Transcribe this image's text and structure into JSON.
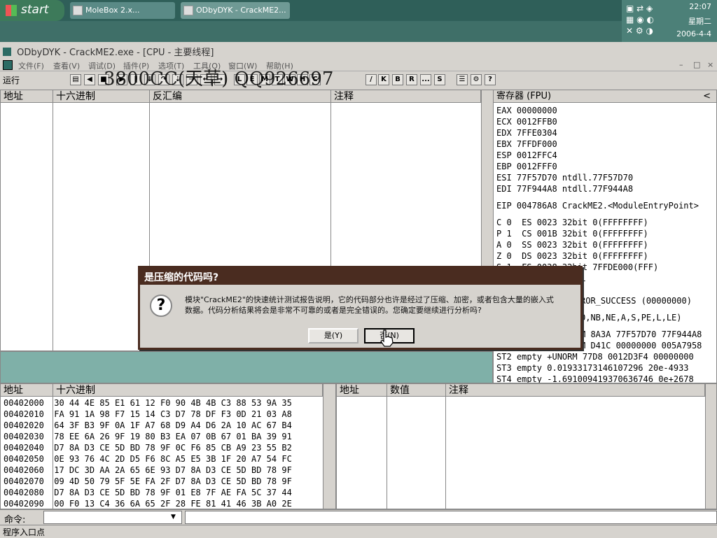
{
  "taskbar": {
    "start_label": "start",
    "tasks": [
      "MoleBox 2.x...",
      "ODbyDYK - CrackME2..."
    ],
    "clock": {
      "time": "22:07",
      "day": "星期二",
      "date": "2006-4-4"
    }
  },
  "window": {
    "title": "ODbyDYK - CrackME2.exe - [CPU - 主要线程]"
  },
  "menu": {
    "items": [
      "文件(F)",
      "查看(V)",
      "调试(D)",
      "插件(P)",
      "选项(T)",
      "工具(O)",
      "窗口(W)",
      "帮助(H)"
    ],
    "window_controls": [
      "–",
      "□",
      "×"
    ]
  },
  "toolbar": {
    "status": "运行",
    "letter_buttons": [
      "L",
      "E",
      "M",
      "T",
      "W",
      "H",
      "C",
      "/",
      "K",
      "B",
      "R",
      "...",
      "S"
    ]
  },
  "watermark": "3800CC(天草)  QQ926697",
  "disasm": {
    "headers": [
      "地址",
      "十六进制",
      "反汇编",
      "注释"
    ]
  },
  "registers": {
    "header": "寄存器 (FPU)",
    "collapse": "<",
    "general": [
      "EAX 00000000",
      "ECX 0012FFB0",
      "EDX 7FFE0304",
      "EBX 7FFDF000",
      "ESP 0012FFC4",
      "EBP 0012FFF0",
      "ESI 77F57D70 ntdll.77F57D70",
      "EDI 77F944A8 ntdll.77F944A8"
    ],
    "eip": "EIP 004786A8 CrackME2.<ModuleEntryPoint>",
    "flags": [
      "C 0  ES 0023 32bit 0(FFFFFFFF)",
      "P 1  CS 001B 32bit 0(FFFFFFFF)",
      "A 0  SS 0023 32bit 0(FFFFFFFF)",
      "Z 0  DS 0023 32bit 0(FFFFFFFF)",
      "S 1  FS 0038 32bit 7FFDE000(FFF)"
    ],
    "partial": [
      "L",
      "ROR_SUCCESS (00000000)",
      "O,NB,NE,A,S,PE,L,LE)",
      "M 8A3A 77F57D70 77F944A8",
      "M D41C 00000000 005A7958"
    ],
    "fpu": [
      "ST2 empty +UNORM 77D8 0012D3F4 00000000",
      "ST3 empty 0.01933173146107296 20e-4933",
      "ST4 empty -1.691009419370636746 0e+2678"
    ]
  },
  "dump": {
    "headers": [
      "地址",
      "十六进制"
    ],
    "rows": [
      {
        "addr": "00402000",
        "hex": "30 44 4E 85 E1 61 12 F0 90 4B 4B C3 88 53 9A 35"
      },
      {
        "addr": "00402010",
        "hex": "FA 91 1A 98 F7 15 14 C3 D7 78 DF F3 0D 21 03 A8"
      },
      {
        "addr": "00402020",
        "hex": "64 3F B3 9F 0A 1F A7 68 D9 A4 D6 2A 10 AC 67 B4"
      },
      {
        "addr": "00402030",
        "hex": "78 EE 6A 26 9F 19 80 B3 EA 07 0B 67 01 BA 39 91"
      },
      {
        "addr": "00402040",
        "hex": "D7 8A D3 CE 5D BD 78 9F 0C F6 85 CB A9 23 55 B2"
      },
      {
        "addr": "00402050",
        "hex": "0E 93 76 4C 2D D5 F6 8C A5 E5 3B 1F 20 A7 54 FC"
      },
      {
        "addr": "00402060",
        "hex": "17 DC 3D AA 2A 65 6E 93 D7 8A D3 CE 5D BD 78 9F"
      },
      {
        "addr": "00402070",
        "hex": "09 4D 50 79 5F 5E FA 2F D7 8A D3 CE 5D BD 78 9F"
      },
      {
        "addr": "00402080",
        "hex": "D7 8A D3 CE 5D BD 78 9F 01 E8 7F AE FA 5C 37 44"
      },
      {
        "addr": "00402090",
        "hex": "00 F0 13 C4 36 6A 65 2F 28 FE 81 41 46 3B A0 2E"
      }
    ]
  },
  "stack": {
    "headers": [
      "地址",
      "数值",
      "注释"
    ]
  },
  "command": {
    "label": "命令:",
    "value": ""
  },
  "statusbar": "程序入口点",
  "dialog": {
    "title": "是压缩的代码吗?",
    "message_line1": "模块\"CrackME2\"的快速统计测试报告说明，它的代码部分也许是经过了压缩、加密，或者包含大量的嵌入式",
    "message_line2": "数据。代码分析结果将会是非常不可靠的或者是完全错误的。您确定要继续进行分析吗?",
    "yes_label": "是(Y)",
    "no_label": "否(N)"
  }
}
